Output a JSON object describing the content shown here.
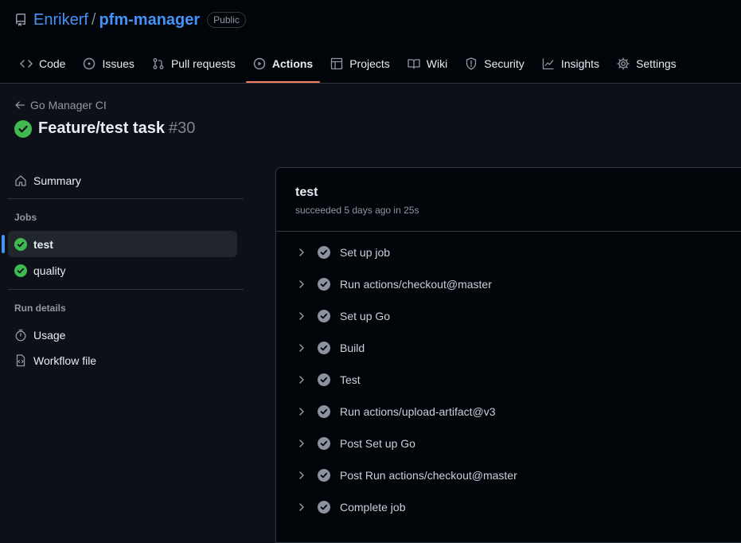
{
  "repo": {
    "owner": "Enrikerf",
    "separator": "/",
    "name": "pfm-manager",
    "visibility": "Public"
  },
  "tabs": [
    {
      "label": "Code",
      "icon": "code-icon"
    },
    {
      "label": "Issues",
      "icon": "issue-icon"
    },
    {
      "label": "Pull requests",
      "icon": "pull-request-icon"
    },
    {
      "label": "Actions",
      "icon": "play-icon",
      "active": true
    },
    {
      "label": "Projects",
      "icon": "table-icon"
    },
    {
      "label": "Wiki",
      "icon": "book-icon"
    },
    {
      "label": "Security",
      "icon": "shield-icon"
    },
    {
      "label": "Insights",
      "icon": "graph-icon"
    },
    {
      "label": "Settings",
      "icon": "gear-icon"
    }
  ],
  "workflow": {
    "back_label": "Go Manager CI",
    "run_title": "Feature/test task",
    "run_number": "#30"
  },
  "sidebar": {
    "summary_label": "Summary",
    "jobs_heading": "Jobs",
    "jobs": [
      {
        "label": "test",
        "selected": true
      },
      {
        "label": "quality"
      }
    ],
    "run_details_heading": "Run details",
    "usage_label": "Usage",
    "workflow_file_label": "Workflow file"
  },
  "job": {
    "name": "test",
    "meta": "succeeded 5 days ago in 25s",
    "steps": [
      "Set up job",
      "Run actions/checkout@master",
      "Set up Go",
      "Build",
      "Test",
      "Run actions/upload-artifact@v3",
      "Post Set up Go",
      "Post Run actions/checkout@master",
      "Complete job"
    ]
  },
  "colors": {
    "accent": "#4493f8",
    "success": "#3fb950",
    "tab_underline": "#f78166",
    "step_check": "#8b949e"
  }
}
